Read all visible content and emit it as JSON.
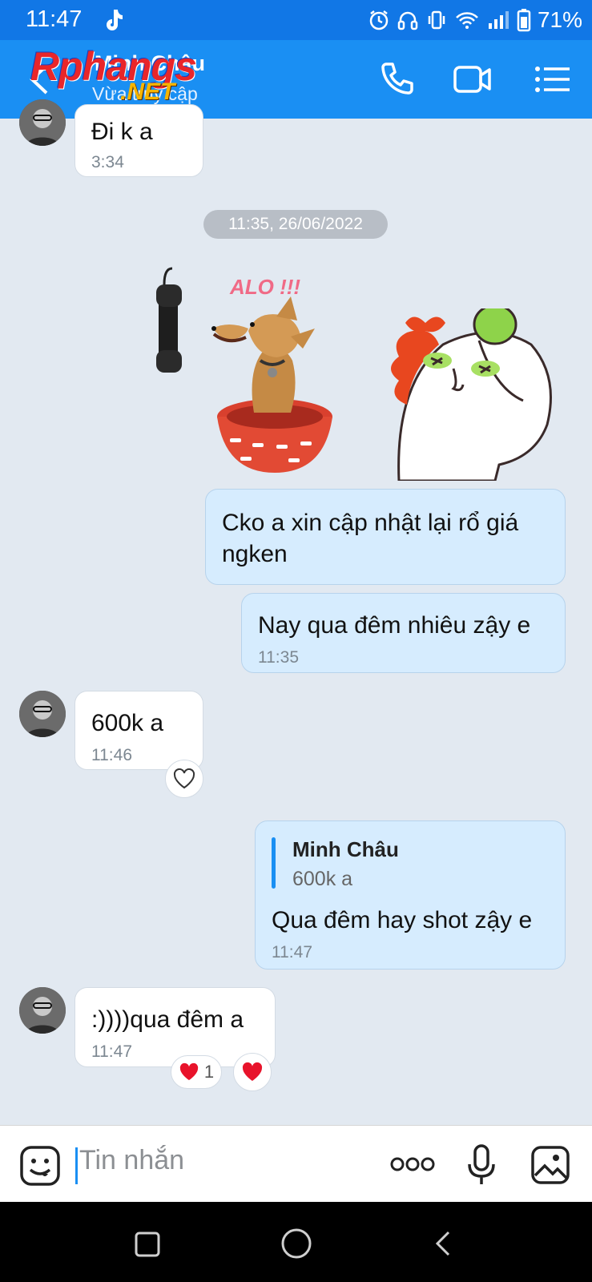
{
  "status_bar": {
    "time": "11:47",
    "battery": "71%"
  },
  "header": {
    "contact_name": "Minh Châu",
    "contact_status": "Vừa truy cập",
    "watermark_main": "Rphangs",
    "watermark_suffix": ".NET"
  },
  "messages": {
    "m1": {
      "text": "Đi k a",
      "time": "3:34"
    },
    "date_separator": "11:35, 26/06/2022",
    "sticker1_text": "ALO !!!",
    "m2": {
      "text_line1": "Cko a xin cập nhật lại rổ giá",
      "text_line2": "ngken"
    },
    "m3": {
      "text": "Nay qua đêm nhiêu zậy e",
      "time": "11:35"
    },
    "m4": {
      "text": "600k a",
      "time": "11:46"
    },
    "m5": {
      "quote_author": "Minh Châu",
      "quote_text": "600k a",
      "text": "Qua đêm hay shot zậy e",
      "time": "11:47"
    },
    "m6": {
      "text": ":))))qua đêm a",
      "time": "11:47",
      "reaction_count": "1"
    }
  },
  "input": {
    "placeholder": "Tin nhắn"
  },
  "colors": {
    "header": "#1a8ff3",
    "statusbar": "#1177e6",
    "chat_bg": "#e2e9f1",
    "outgoing": "#d6ecfe",
    "reaction": "#e8132b"
  }
}
